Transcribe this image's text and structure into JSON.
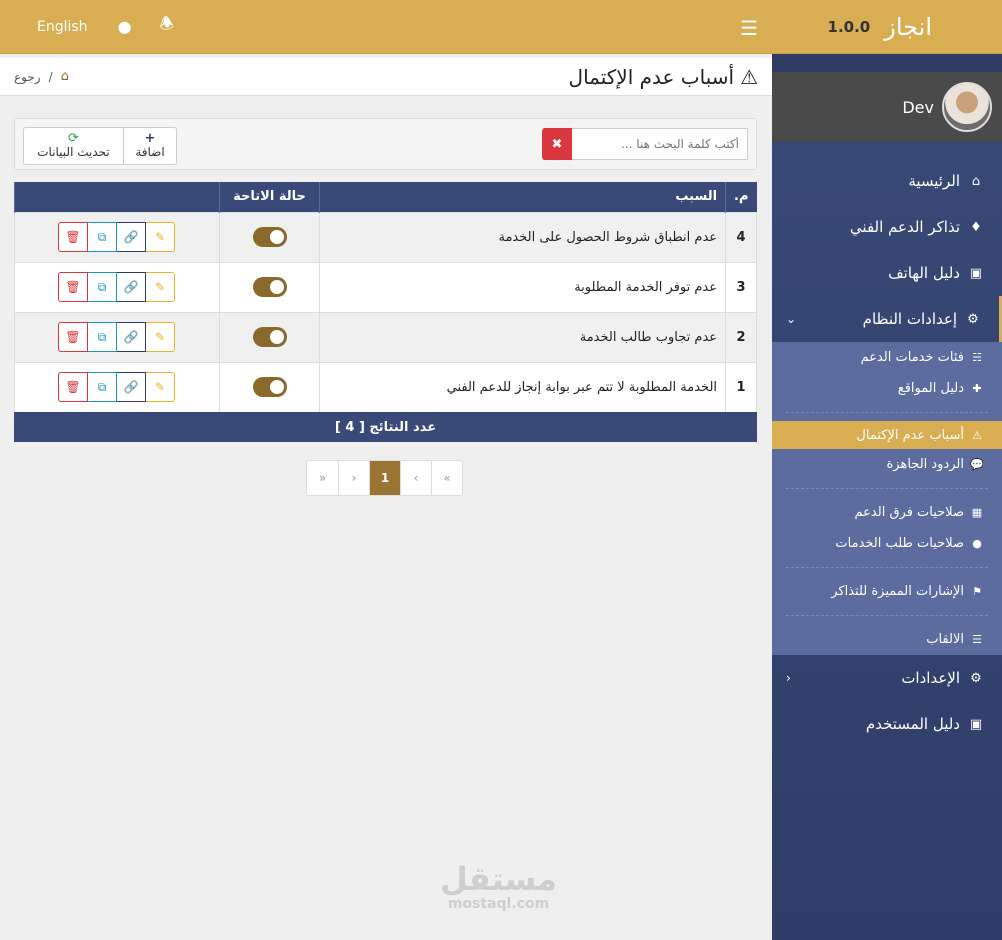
{
  "topbar": {
    "lang": "English",
    "user_icon": "user-icon",
    "bell_icon": "bell-icon",
    "menu_icon": "hamburger-icon",
    "accent": "#d9ae52"
  },
  "brand": {
    "name": "انجاز",
    "version": "1.0.0"
  },
  "user": {
    "name": "Dev"
  },
  "sidebar": {
    "items": [
      {
        "label": "الرئيسية",
        "icon": "home-icon"
      },
      {
        "label": "تذاكر الدعم الفني",
        "icon": "ticket-icon"
      },
      {
        "label": "دليل الهاتف",
        "icon": "address-book-icon"
      },
      {
        "label": "إعدادات النظام",
        "icon": "cogs-icon"
      }
    ],
    "sub": [
      {
        "label": "فئات خدمات الدعم",
        "icon": "sitemap-icon"
      },
      {
        "label": "دليل المواقع",
        "icon": "signs-icon"
      },
      {
        "label": "أسباب عدم الإكتمال",
        "icon": "warning-icon"
      },
      {
        "label": "الردود الجاهزة",
        "icon": "comment-icon"
      },
      {
        "label": "صلاحيات فرق الدعم",
        "icon": "id-badge-icon"
      },
      {
        "label": "صلاحيات طلب الخدمات",
        "icon": "users-icon"
      },
      {
        "label": "الإشارات المميزة للتذاكر",
        "icon": "tag-icon"
      },
      {
        "label": "الالقاب",
        "icon": "sliders-icon"
      }
    ],
    "bottom": [
      {
        "label": "الإعدادات",
        "icon": "cogs-icon"
      },
      {
        "label": "دليل المستخدم",
        "icon": "address-book-icon"
      }
    ]
  },
  "page": {
    "title": "أسباب عدم الإكتمال",
    "back": "رجوع"
  },
  "toolbar": {
    "add_label": "اضافة",
    "refresh_label": "تحديث البيانات",
    "search_placeholder": "أكتب كلمة البحث هنا ..."
  },
  "table": {
    "headers": {
      "num": "م.",
      "reason": "السبب",
      "status": "حالة الاتاحة"
    },
    "rows": [
      {
        "num": "4",
        "reason": "عدم انطباق شروط الحصول على الخدمة",
        "enabled": true
      },
      {
        "num": "3",
        "reason": "عدم توفر الخدمة المطلوبة",
        "enabled": true
      },
      {
        "num": "2",
        "reason": "عدم تجاوب طالب الخدمة",
        "enabled": true
      },
      {
        "num": "1",
        "reason": "الخدمة المطلوبة لا تتم عبر بوابة إنجاز للدعم الفني",
        "enabled": true
      }
    ],
    "footer": "عدد النتائج [ 4 ]"
  },
  "pagination": {
    "first": "«",
    "prev": "‹",
    "current": "1",
    "next": "›",
    "last": "»"
  },
  "watermark": {
    "ar": "مستقل",
    "en": "mostaql.com"
  }
}
